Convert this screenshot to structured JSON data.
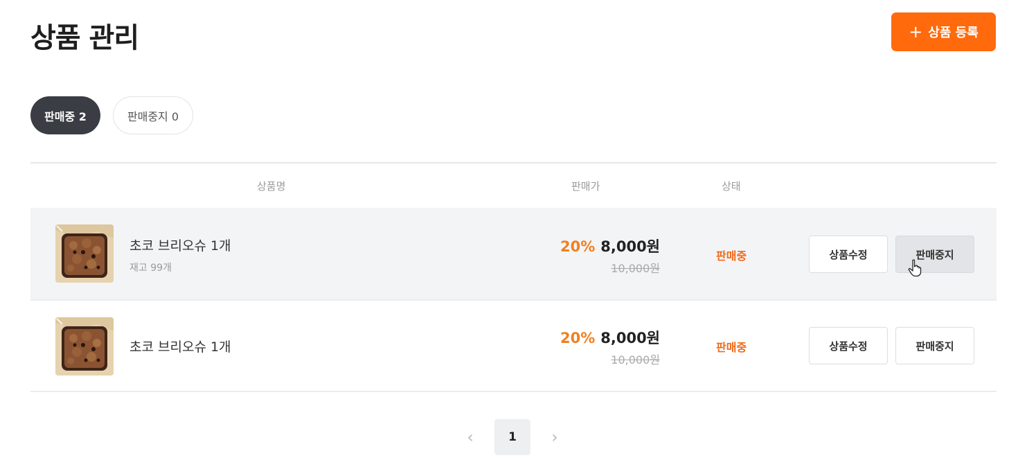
{
  "header": {
    "title": "상품 관리",
    "add_button_label": "상품 등록",
    "add_button_icon": "plus-icon"
  },
  "filters": [
    {
      "label": "판매중 2",
      "active": true
    },
    {
      "label": "판매중지 0",
      "active": false
    }
  ],
  "table": {
    "columns": {
      "name": "상품명",
      "price": "판매가",
      "status": "상태"
    },
    "rows": [
      {
        "name": "초코 브리오슈 1개",
        "stock": "재고 99개",
        "discount": "20%",
        "sale_price": "8,000원",
        "original_price": "10,000원",
        "status": "판매중",
        "edit_label": "상품수정",
        "stop_label": "판매중지"
      },
      {
        "name": "초코 브리오슈 1개",
        "discount": "20%",
        "sale_price": "8,000원",
        "original_price": "10,000원",
        "status": "판매중",
        "edit_label": "상품수정",
        "stop_label": "판매중지"
      }
    ]
  },
  "pagination": {
    "current_page": "1",
    "prev_icon": "chevron-left-icon",
    "next_icon": "chevron-right-icon"
  },
  "colors": {
    "accent": "#ff6a0d",
    "discount": "#f08020",
    "status_active": "#f06a1a",
    "active_tab": "#3a3d43"
  }
}
